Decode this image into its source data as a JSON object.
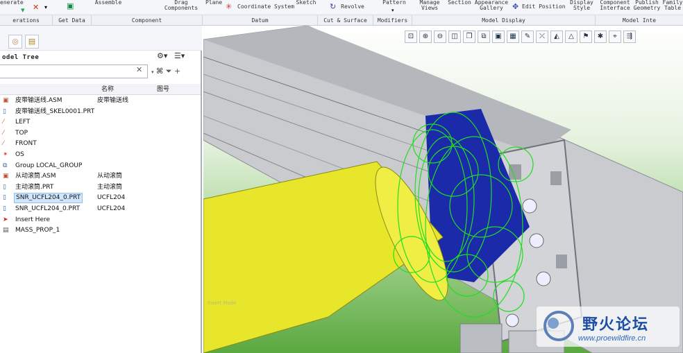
{
  "ribbon": {
    "top_labels": [
      "enerate",
      "Assemble",
      "Drag\nComponents",
      "Plane",
      "Coordinate System",
      "Sketch",
      "Revolve",
      "Pattern",
      "Manage\nViews",
      "Section",
      "Appearance\nGallery",
      "Edit Position",
      "Display\nStyle",
      "Component\nInterface",
      "Publish\nGeometry",
      "Family\nTable"
    ],
    "groups": [
      "erations",
      "Get Data",
      "Component",
      "Datum",
      "Cut & Surface",
      "Modifiers",
      "Model Display",
      "Model Inte"
    ]
  },
  "panel": {
    "title": "odel Tree",
    "search_placeholder": "",
    "col_name": "名称",
    "col_drawing": "图号"
  },
  "tree": [
    {
      "icon": "assembly-icon",
      "name": "皮带输送线.ASM",
      "c2": "皮带输送线"
    },
    {
      "icon": "part-icon",
      "name": "皮带输送线_SKEL0001.PRT",
      "c2": ""
    },
    {
      "icon": "datum-plane-icon",
      "name": "LEFT",
      "c2": ""
    },
    {
      "icon": "datum-plane-icon",
      "name": "TOP",
      "c2": ""
    },
    {
      "icon": "datum-plane-icon",
      "name": "FRONT",
      "c2": ""
    },
    {
      "icon": "csys-icon",
      "name": "OS",
      "c2": ""
    },
    {
      "icon": "group-icon",
      "name": "Group LOCAL_GROUP",
      "c2": ""
    },
    {
      "icon": "assembly-icon",
      "name": "从动滚筒.ASM",
      "c2": "从动滚筒"
    },
    {
      "icon": "part-icon",
      "name": "主动滚筒.PRT",
      "c2": "主动滚筒"
    },
    {
      "icon": "part-icon",
      "name": "SNR_UCFL204_0.PRT",
      "c2": "UCFL204",
      "selected": true
    },
    {
      "icon": "part-icon",
      "name": "SNR_UCFL204_0.PRT",
      "c2": "UCFL204"
    },
    {
      "icon": "insert-here-icon",
      "name": "Insert Here",
      "c2": ""
    },
    {
      "icon": "analysis-icon",
      "name": "MASS_PROP_1",
      "c2": ""
    }
  ],
  "viewport": {
    "faint_text": "Insert Mode",
    "watermark_cn": "野火论坛",
    "watermark_url": "www.proewildfire.cn"
  },
  "colors": {
    "accent_blue": "#1c4fa3",
    "viewport_green": "#5aa840",
    "cylinder_yellow": "#e8e62a",
    "wireframe_green": "#22dd22",
    "bearing_blue": "#1a2aa8"
  }
}
